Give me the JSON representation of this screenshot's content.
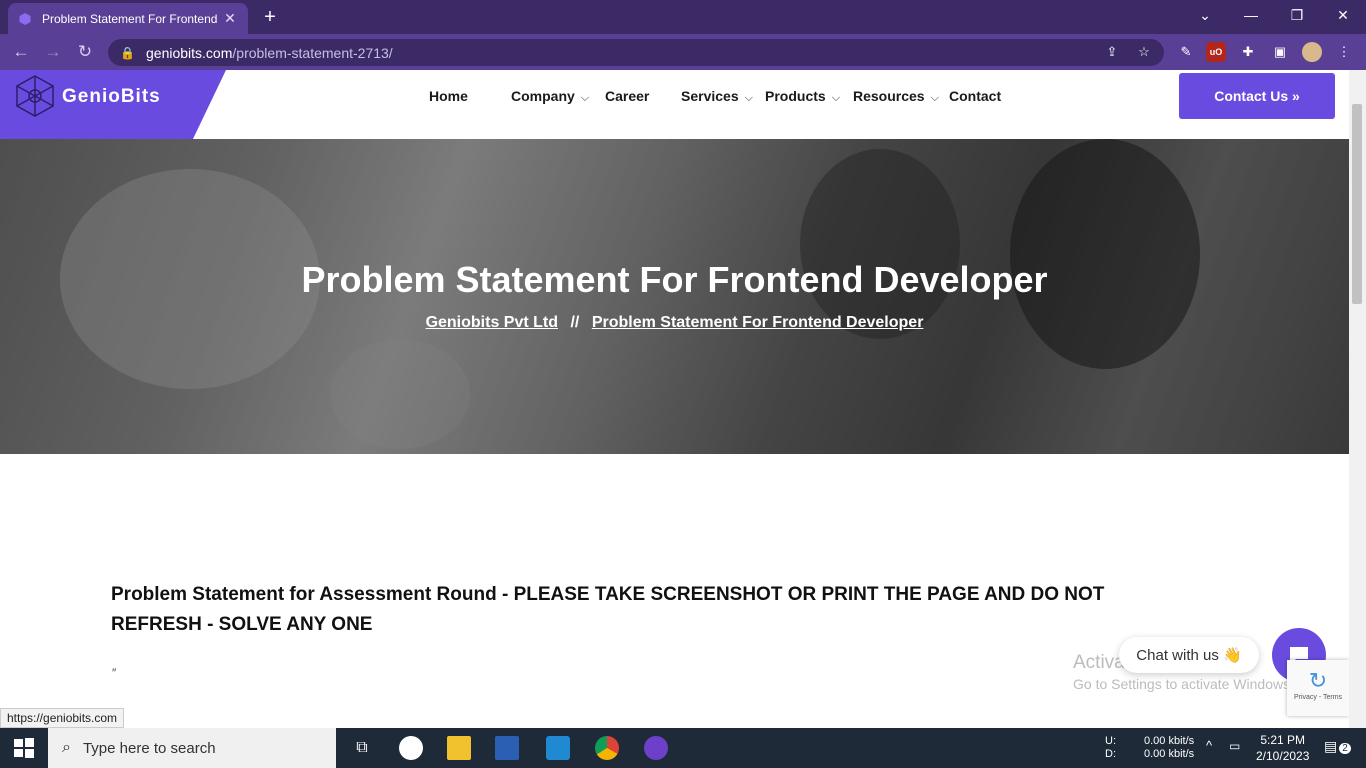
{
  "browser": {
    "tab_title": "Problem Statement For Frontend",
    "tab_close": "✕",
    "new_tab": "+",
    "url_host": "geniobits.com",
    "url_path": "/problem-statement-2713/",
    "window": {
      "minimize": "—",
      "restore": "❐",
      "close": "✕",
      "tabsearch": "⌄"
    }
  },
  "site": {
    "logo_text": "GenioBits",
    "nav": [
      {
        "label": "Home",
        "has_menu": false
      },
      {
        "label": "Company",
        "has_menu": true
      },
      {
        "label": "Career",
        "has_menu": false
      },
      {
        "label": "Services",
        "has_menu": true
      },
      {
        "label": "Products",
        "has_menu": true
      },
      {
        "label": "Resources",
        "has_menu": true
      },
      {
        "label": "Contact",
        "has_menu": false
      }
    ],
    "contact_button": "Contact Us »"
  },
  "hero": {
    "title": "Problem Statement For Frontend Developer",
    "breadcrumb_home": "Geniobits Pvt Ltd",
    "breadcrumb_sep": "//",
    "breadcrumb_current": "Problem Statement For Frontend Developer"
  },
  "content": {
    "heading": "Problem Statement for Assessment Round - PLEASE TAKE SCREENSHOT OR PRINT THE PAGE AND DO NOT REFRESH - SOLVE ANY ONE",
    "quote_mark": "″"
  },
  "overlays": {
    "activate_title": "Activate Windows",
    "activate_sub": "Go to Settings to activate Windows.",
    "chat_label": "Chat with us 👋",
    "recaptcha": "Privacy - Terms",
    "status_url": "https://geniobits.com"
  },
  "taskbar": {
    "search_placeholder": "Type here to search",
    "net_up_label": "U:",
    "net_down_label": "D:",
    "net_up": "0.00 kbit/s",
    "net_down": "0.00 kbit/s",
    "time": "5:21 PM",
    "date": "2/10/2023",
    "notifications": "2"
  },
  "colors": {
    "brand": "#6a4be0",
    "chrome_dark": "#3b2a66",
    "chrome_mid": "#5a3f96"
  }
}
